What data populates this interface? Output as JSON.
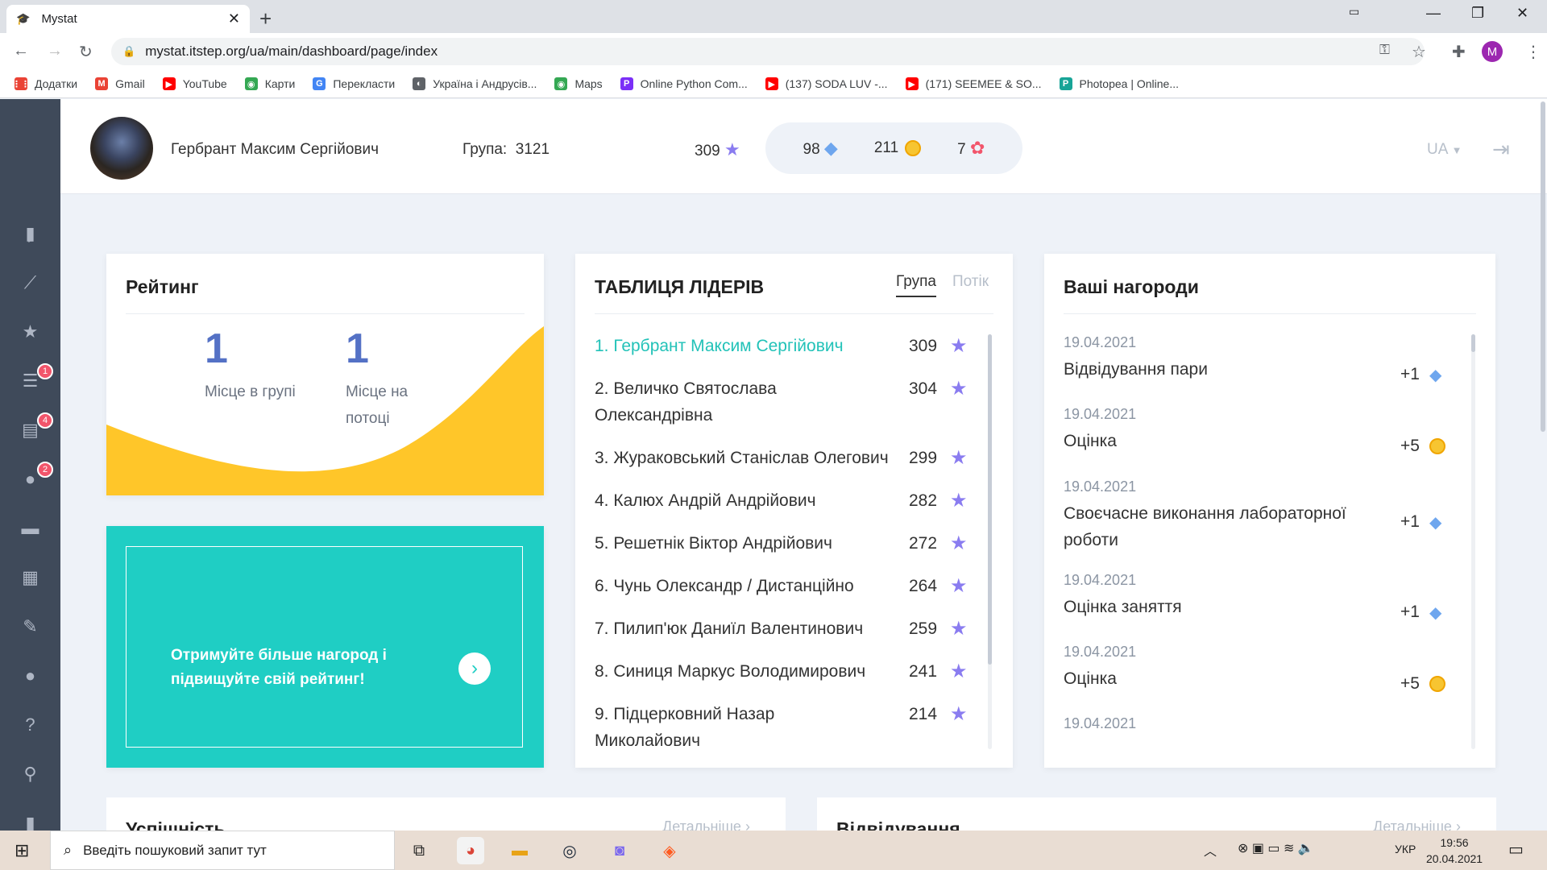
{
  "browser": {
    "tab_title": "Mystat",
    "url": "mystat.itstep.org/ua/main/dashboard/page/index",
    "profile_initial": "M",
    "bookmarks": [
      {
        "label": "Додатки",
        "color": "#ea4335",
        "glyph": "⋮⋮"
      },
      {
        "label": "Gmail",
        "color": "#ea4335",
        "glyph": "M"
      },
      {
        "label": "YouTube",
        "color": "#ff0000",
        "glyph": "▶"
      },
      {
        "label": "Карти",
        "color": "#34a853",
        "glyph": "◉"
      },
      {
        "label": "Перекласти",
        "color": "#4285f4",
        "glyph": "G"
      },
      {
        "label": "Україна і Андрусів...",
        "color": "#5f6368",
        "glyph": "◐"
      },
      {
        "label": "Maps",
        "color": "#34a853",
        "glyph": "◉"
      },
      {
        "label": "Online Python Com...",
        "color": "#7b2ff7",
        "glyph": "P"
      },
      {
        "label": "(137) SODA LUV -...",
        "color": "#ff0000",
        "glyph": "▶"
      },
      {
        "label": "(171) SEEMEE & SO...",
        "color": "#ff0000",
        "glyph": "▶"
      },
      {
        "label": "Photopea | Online...",
        "color": "#18a497",
        "glyph": "P"
      }
    ]
  },
  "sidebar": {
    "expand_icon": "chevron-right-icon",
    "items": [
      {
        "icon": "bar-chart-icon",
        "glyph": "▮",
        "badge": ""
      },
      {
        "icon": "line-chart-icon",
        "glyph": "⟋",
        "badge": ""
      },
      {
        "icon": "star-icon",
        "glyph": "★",
        "badge": ""
      },
      {
        "icon": "list-icon",
        "glyph": "☰",
        "badge": "1"
      },
      {
        "icon": "books-icon",
        "glyph": "▤",
        "badge": "4"
      },
      {
        "icon": "chat-icon",
        "glyph": "●",
        "badge": "2"
      },
      {
        "icon": "card-icon",
        "glyph": "▬",
        "badge": ""
      },
      {
        "icon": "calendar-icon",
        "glyph": "▦",
        "badge": ""
      },
      {
        "icon": "pen-icon",
        "glyph": "✎",
        "badge": ""
      },
      {
        "icon": "user-icon",
        "glyph": "●",
        "badge": ""
      },
      {
        "icon": "help-icon",
        "glyph": "?",
        "badge": ""
      },
      {
        "icon": "location-icon",
        "glyph": "⚲",
        "badge": ""
      },
      {
        "icon": "microphone-icon",
        "glyph": "▮",
        "badge": ""
      }
    ]
  },
  "header": {
    "user_name": "Гербрант Максим Сергійович",
    "group_label": "Група:",
    "group_value": "3121",
    "stars": "309",
    "gems": "98",
    "coins": "211",
    "badges": "7",
    "language": "UA"
  },
  "rating": {
    "title": "Рейтинг",
    "group_place": "1",
    "group_place_label": "Місце в групі",
    "stream_place": "1",
    "stream_place_label_1": "Місце на",
    "stream_place_label_2": "потоці",
    "accent_color": "#ffc629"
  },
  "promo": {
    "text_1": "Отримуйте більше нагород і",
    "text_2": "підвищуйте свій рейтинг!",
    "bg_color": "#1fcec4"
  },
  "leaders": {
    "title": "ТАБЛИЦЯ ЛІДЕРІВ",
    "tab_group": "Група",
    "tab_stream": "Потік",
    "rows": [
      {
        "line1": "1.  Гербрант Максим Сергійович",
        "line2": "",
        "score": "309"
      },
      {
        "line1": "2.  Величко Святослава",
        "line2": "Олександрівна",
        "score": "304"
      },
      {
        "line1": "3.  Жураковський Станіслав Олегович",
        "line2": "",
        "score": "299"
      },
      {
        "line1": "4.  Калюх Андрій Андрійович",
        "line2": "",
        "score": "282"
      },
      {
        "line1": "5.  Решетнік Віктор Андрійович",
        "line2": "",
        "score": "272"
      },
      {
        "line1": "6.  Чунь Олександр / Дистанційно",
        "line2": "",
        "score": "264"
      },
      {
        "line1": "7.  Пилип'юк Даниїл Валентинович",
        "line2": "",
        "score": "259"
      },
      {
        "line1": "8.  Синиця Маркус Володимирович",
        "line2": "",
        "score": "241"
      },
      {
        "line1": "9.  Підцерковний Назар",
        "line2": "Миколайович",
        "score": "214"
      }
    ]
  },
  "awards": {
    "title": "Ваші нагороди",
    "items": [
      {
        "date": "19.04.2021",
        "name": "Відвідування пари",
        "value": "+1",
        "type": "gem"
      },
      {
        "date": "19.04.2021",
        "name": "Оцінка",
        "value": "+5",
        "type": "coin"
      },
      {
        "date": "19.04.2021",
        "name": "Своєчасне виконання лабораторної роботи",
        "value": "+1",
        "type": "gem"
      },
      {
        "date": "19.04.2021",
        "name": "Оцінка заняття",
        "value": "+1",
        "type": "gem"
      },
      {
        "date": "19.04.2021",
        "name": "Оцінка",
        "value": "+5",
        "type": "coin"
      },
      {
        "date": "19.04.2021",
        "name": "",
        "value": "",
        "type": ""
      }
    ]
  },
  "bottom": {
    "progress_title": "Успішність",
    "progress_more": "Детальніше",
    "attendance_title": "Відвідування",
    "attendance_more": "Детальніше"
  },
  "taskbar": {
    "search_placeholder": "Введіть пошуковий запит тут",
    "language": "УКР",
    "time": "19:56",
    "date": "20.04.2021"
  }
}
